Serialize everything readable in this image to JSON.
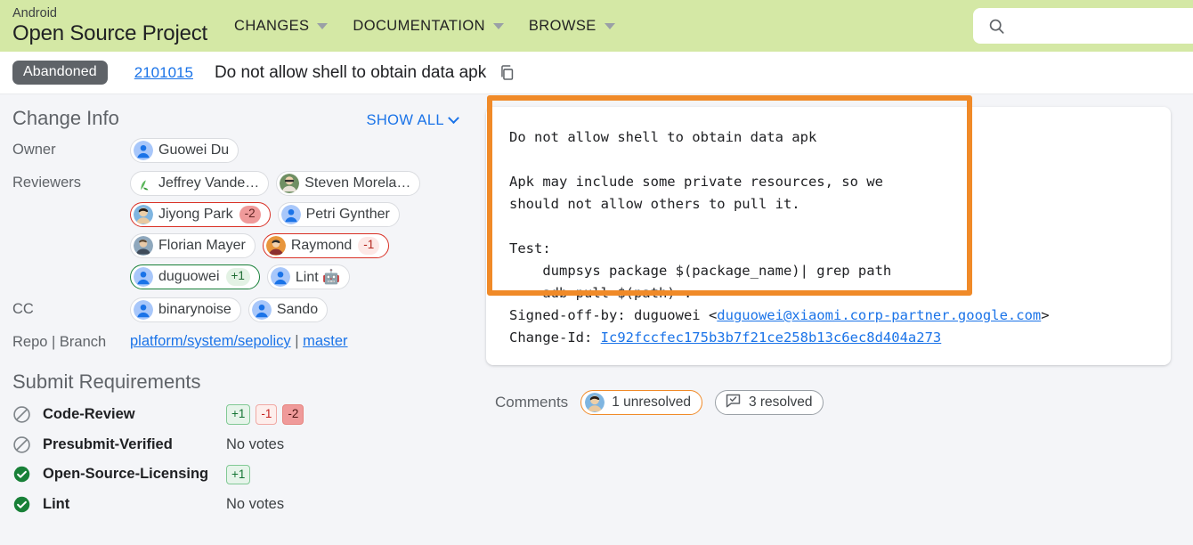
{
  "header": {
    "brand_small": "Android",
    "brand_big": "Open Source Project",
    "nav": [
      {
        "label": "CHANGES",
        "icon": "chevron-down-icon"
      },
      {
        "label": "DOCUMENTATION",
        "icon": "chevron-down-icon"
      },
      {
        "label": "BROWSE",
        "icon": "chevron-down-icon"
      }
    ],
    "search": {
      "placeholder": "",
      "value": "",
      "icon": "search-icon"
    },
    "bg_color": "#d4e8a5"
  },
  "change_strip": {
    "status": "Abandoned",
    "status_color": "#5f6368",
    "change_number": "2101015",
    "title": "Do not allow shell to obtain data apk",
    "copy_icon": "copy-icon"
  },
  "change_info": {
    "title": "Change Info",
    "show_all": "SHOW ALL",
    "labels": {
      "owner": "Owner",
      "reviewers": "Reviewers",
      "cc": "CC",
      "repo_branch": "Repo | Branch"
    },
    "owner": [
      {
        "name": "Guowei Du",
        "vote": "",
        "avatar": "default-blue"
      }
    ],
    "reviewers": [
      {
        "name": "Jeffrey Vande…",
        "vote": "",
        "avatar": "photo-green-plant"
      },
      {
        "name": "Steven Morela…",
        "vote": "",
        "avatar": "photo-glasses"
      },
      {
        "name": "Jiyong Park",
        "vote": "-2",
        "avatar": "photo-person"
      },
      {
        "name": "Petri Gynther",
        "vote": "",
        "avatar": "default-blue"
      },
      {
        "name": "Florian Mayer",
        "vote": "",
        "avatar": "photo-person"
      },
      {
        "name": "Raymond",
        "vote": "-1",
        "avatar": "photo-orange"
      },
      {
        "name": "duguowei",
        "vote": "+1",
        "avatar": "default-blue"
      },
      {
        "name": "Lint 🤖",
        "vote": "",
        "avatar": "default-blue"
      }
    ],
    "cc": [
      {
        "name": "binarynoise",
        "vote": "",
        "avatar": "default-blue"
      },
      {
        "name": "Sando",
        "vote": "",
        "avatar": "default-blue"
      }
    ],
    "repo": "platform/system/sepolicy",
    "branch_sep": " | ",
    "branch": "master"
  },
  "submit_requirements": {
    "title": "Submit Requirements",
    "rows": [
      {
        "name": "Code-Review",
        "status": "blocked",
        "status_icon": "circle-slash-icon",
        "votes": [
          "+1",
          "-1",
          "-2"
        ],
        "no_votes_text": ""
      },
      {
        "name": "Presubmit-Verified",
        "status": "blocked",
        "status_icon": "circle-slash-icon",
        "votes": [],
        "no_votes_text": "No votes"
      },
      {
        "name": "Open-Source-Licensing",
        "status": "satisfied",
        "status_icon": "check-circle-icon",
        "votes": [
          "+1"
        ],
        "no_votes_text": ""
      },
      {
        "name": "Lint",
        "status": "satisfied",
        "status_icon": "check-circle-icon",
        "votes": [],
        "no_votes_text": "No votes"
      }
    ]
  },
  "commit_message": {
    "body": "Do not allow shell to obtain data apk\n\nApk may include some private resources, so we\nshould not allow others to pull it.\n\nTest:\n    dumpsys package $(package_name)| grep path\n    adb pull $(path) .\n",
    "signed_off_prefix": "Signed-off-by: duguowei <",
    "signed_off_email": "duguowei@xiaomi.corp-partner.google.com",
    "signed_off_suffix": ">",
    "change_id_prefix": "Change-Id: ",
    "change_id": "Ic92fccfec175b3b7f21ce258b13c6ec8d404a273"
  },
  "annotation": {
    "highlight_color": "#f08a28",
    "shape": "rectangle"
  },
  "comments": {
    "label": "Comments",
    "unresolved": {
      "text": "1 unresolved",
      "avatar": "photo-person",
      "border_color": "#f08a28"
    },
    "resolved": {
      "text": "3 resolved",
      "icon": "comment-check-icon",
      "border_color": "#9aa0a6"
    }
  }
}
